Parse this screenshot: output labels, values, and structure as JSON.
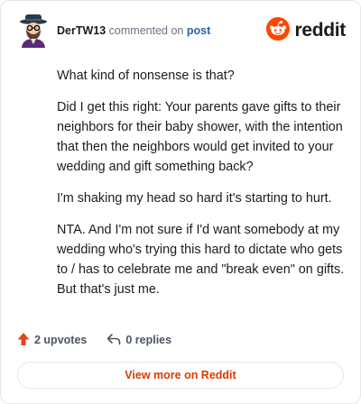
{
  "comment": {
    "author": "DerTW13",
    "action_text": "commented on",
    "post_link": "post",
    "paragraphs": [
      "What kind of nonsense is that?",
      "Did I get this right: Your parents gave gifts to their neighbors for their baby shower, with the intention that then the neighbors would get invited to your wedding and gift something back?",
      "I'm shaking my head so hard it's starting to hurt.",
      "NTA. And I'm not sure if I'd want somebody at my wedding who's trying this hard to dictate who gets to / has to celebrate me and \"break even\" on gifts. But that's just me."
    ]
  },
  "brand": {
    "wordmark": "reddit",
    "icon": "reddit-snoo-icon",
    "color": "#ff4500"
  },
  "stats": {
    "upvotes": "2 upvotes",
    "replies": "0 replies",
    "upvote_icon": "upvote-arrow-icon",
    "reply_icon": "reply-arrow-icon",
    "upvote_color": "#e0451e"
  },
  "cta": {
    "label": "View more on Reddit",
    "color": "#d93a00"
  }
}
